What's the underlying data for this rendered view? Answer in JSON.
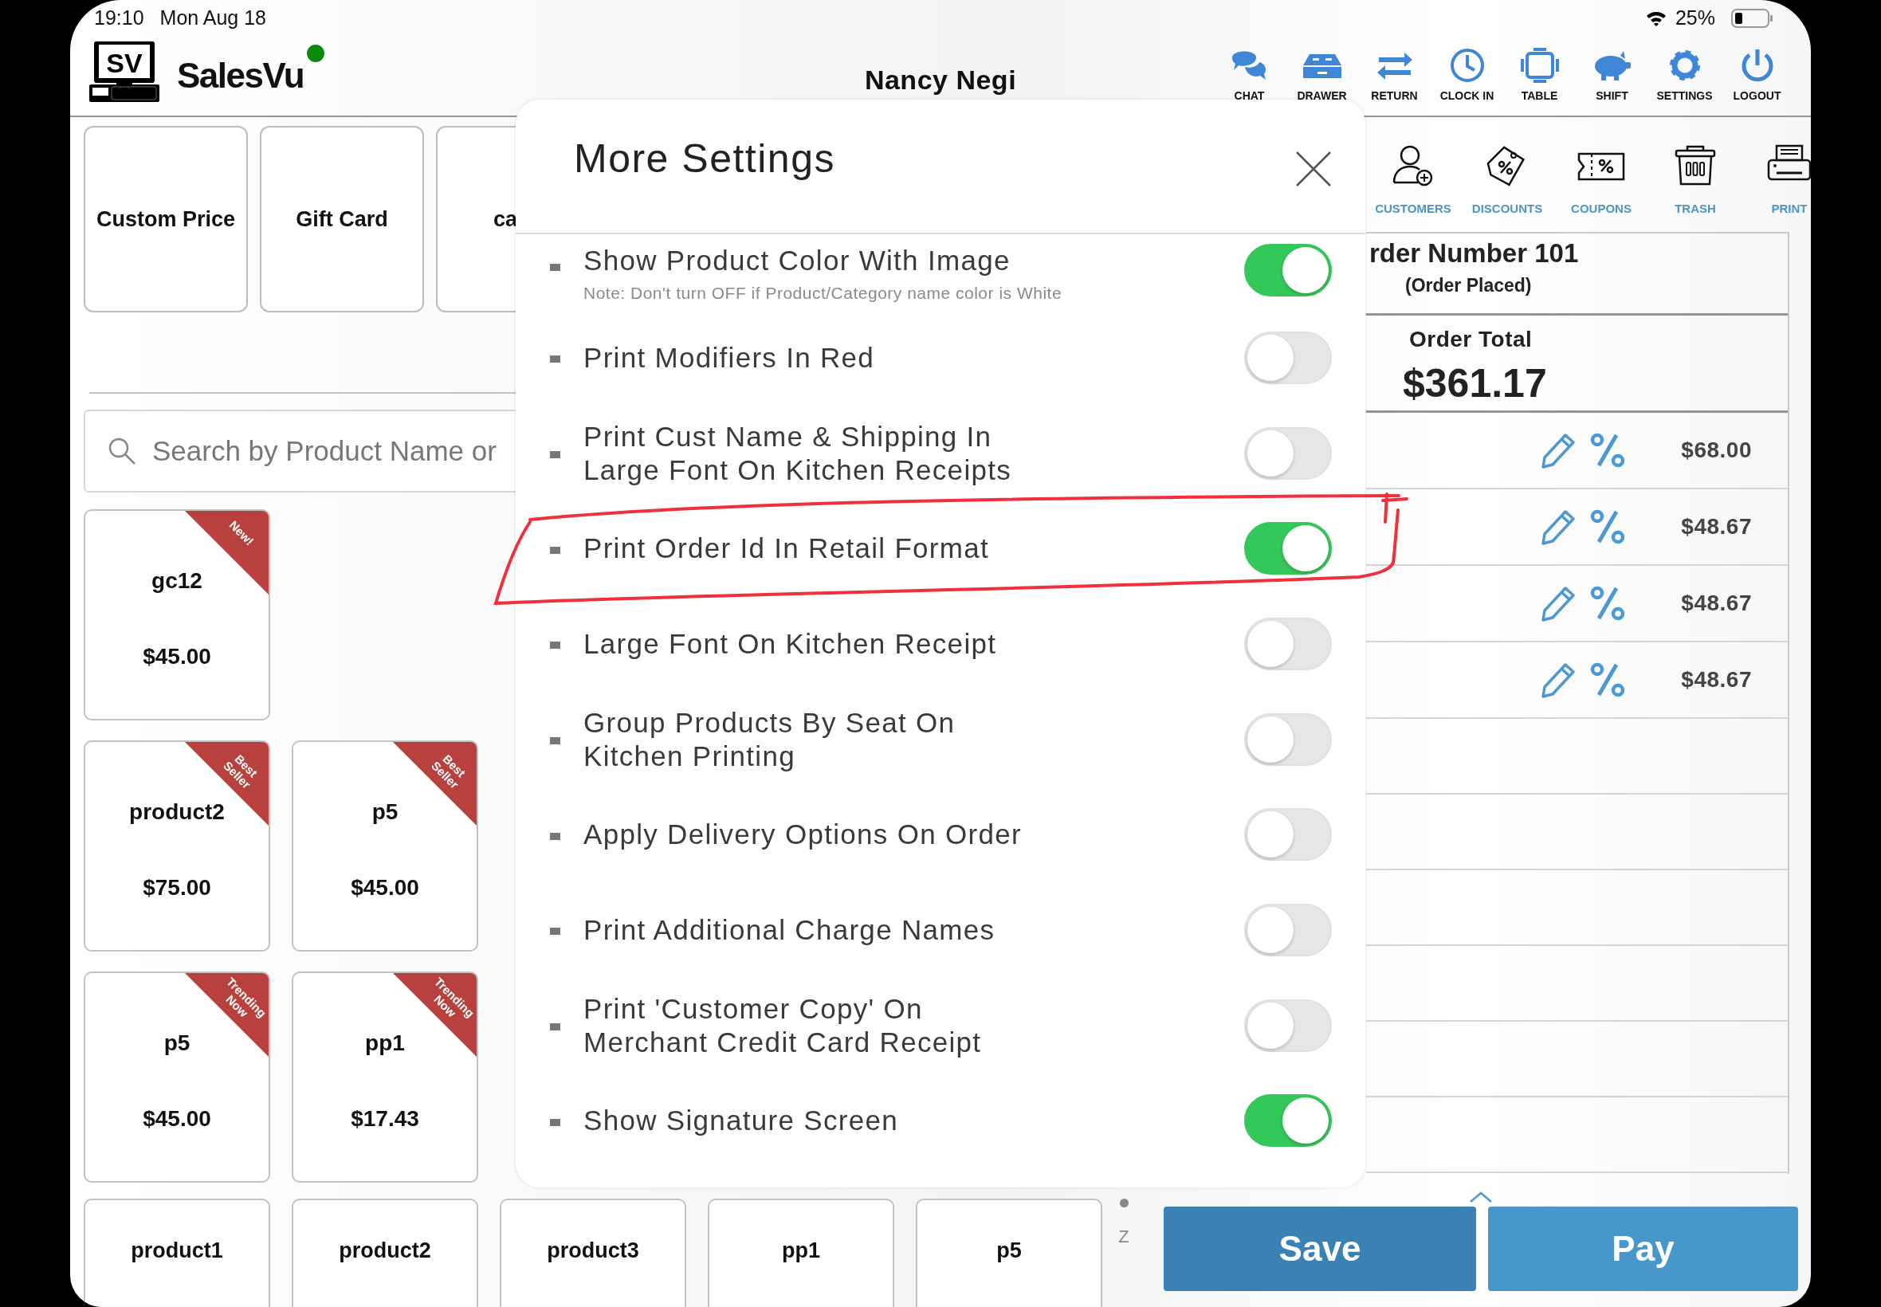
{
  "status_bar": {
    "time": "19:10",
    "date": "Mon Aug 18",
    "battery": "25%"
  },
  "header": {
    "logo_mark": "SV",
    "app_name": "SalesVu",
    "online": true,
    "user": "Nancy Negi"
  },
  "toolbar": [
    {
      "label": "CHAT"
    },
    {
      "label": "DRAWER"
    },
    {
      "label": "RETURN"
    },
    {
      "label": "CLOCK IN"
    },
    {
      "label": "TABLE"
    },
    {
      "label": "SHIFT"
    },
    {
      "label": "SETTINGS"
    },
    {
      "label": "LOGOUT"
    }
  ],
  "quick_tiles": [
    {
      "label": "Custom Price"
    },
    {
      "label": "Gift Card"
    },
    {
      "label": "ca"
    }
  ],
  "search": {
    "placeholder": "Search by Product Name or"
  },
  "products": [
    [
      {
        "name": "gc12",
        "price": "$45.00",
        "ribbon": "New!"
      }
    ],
    [
      {
        "name": "product2",
        "price": "$75.00",
        "ribbon": "Best Seller"
      },
      {
        "name": "p5",
        "price": "$45.00",
        "ribbon": "Best Seller"
      }
    ],
    [
      {
        "name": "p5",
        "price": "$45.00",
        "ribbon": "Trending Now"
      },
      {
        "name": "pp1",
        "price": "$17.43",
        "ribbon": "Trending Now"
      }
    ]
  ],
  "bottom_products": [
    {
      "name": "product1"
    },
    {
      "name": "product2"
    },
    {
      "name": "product3"
    },
    {
      "name": "pp1"
    },
    {
      "name": "p5"
    }
  ],
  "pager": {
    "label": "Z"
  },
  "actions": [
    {
      "label": "Save"
    },
    {
      "label": "Pay"
    }
  ],
  "side_toolbar": [
    {
      "label": "CUSTOMERS"
    },
    {
      "label": "DISCOUNTS"
    },
    {
      "label": "COUPONS"
    },
    {
      "label": "TRASH"
    },
    {
      "label": "PRINT"
    }
  ],
  "order": {
    "number": "rder Number 101",
    "status": "(Order Placed)",
    "total_label": "Order Total",
    "total": "$361.17",
    "lines": [
      {
        "price": "$68.00"
      },
      {
        "price": "$48.67"
      },
      {
        "price": "$48.67"
      },
      {
        "price": "$48.67"
      }
    ]
  },
  "modal": {
    "title": "More Settings",
    "settings": [
      {
        "label": "Show Product Color With Image",
        "note": "Note: Don't turn OFF if Product/Category name color is White",
        "on": true
      },
      {
        "label": "Print Modifiers In Red",
        "on": false
      },
      {
        "label": "Print Cust Name & Shipping In Large Font On Kitchen Receipts",
        "on": false
      },
      {
        "label": "Print Order Id In Retail Format",
        "on": true
      },
      {
        "label": "Large Font On Kitchen Receipt",
        "on": false
      },
      {
        "label": "Group Products By Seat On Kitchen Printing",
        "on": false
      },
      {
        "label": "Apply Delivery Options On Order",
        "on": false
      },
      {
        "label": "Print Additional Charge Names",
        "on": false
      },
      {
        "label": "Print 'Customer Copy' On Merchant Credit Card Receipt",
        "on": false
      },
      {
        "label": "Show Signature Screen",
        "on": true
      }
    ]
  }
}
